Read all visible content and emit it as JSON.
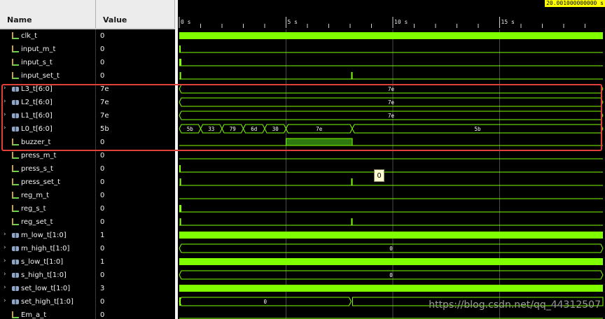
{
  "header": {
    "name_label": "Name",
    "value_label": "Value"
  },
  "ruler": {
    "ticks": [
      "0 s",
      "5 s",
      "10 s",
      "15 s"
    ],
    "cursor_time": "20.001000000000 s"
  },
  "signals": [
    {
      "name": "clk_t",
      "value": "0",
      "type": "bit",
      "expandable": false
    },
    {
      "name": "input_m_t",
      "value": "0",
      "type": "bit",
      "expandable": false
    },
    {
      "name": "input_s_t",
      "value": "0",
      "type": "bit",
      "expandable": false
    },
    {
      "name": "input_set_t",
      "value": "0",
      "type": "bit",
      "expandable": false
    },
    {
      "name": "L3_t[6:0]",
      "value": "7e",
      "type": "bus",
      "expandable": true
    },
    {
      "name": "L2_t[6:0]",
      "value": "7e",
      "type": "bus",
      "expandable": true
    },
    {
      "name": "L1_t[6:0]",
      "value": "7e",
      "type": "bus",
      "expandable": true
    },
    {
      "name": "L0_t[6:0]",
      "value": "5b",
      "type": "bus",
      "expandable": true
    },
    {
      "name": "buzzer_t",
      "value": "0",
      "type": "bit",
      "expandable": false
    },
    {
      "name": "press_m_t",
      "value": "0",
      "type": "bit",
      "expandable": false
    },
    {
      "name": "press_s_t",
      "value": "0",
      "type": "bit",
      "expandable": false
    },
    {
      "name": "press_set_t",
      "value": "0",
      "type": "bit",
      "expandable": false
    },
    {
      "name": "reg_m_t",
      "value": "0",
      "type": "bit",
      "expandable": false
    },
    {
      "name": "reg_s_t",
      "value": "0",
      "type": "bit",
      "expandable": false
    },
    {
      "name": "reg_set_t",
      "value": "0",
      "type": "bit",
      "expandable": false
    },
    {
      "name": "m_low_t[1:0]",
      "value": "1",
      "type": "bus",
      "expandable": true
    },
    {
      "name": "m_high_t[1:0]",
      "value": "0",
      "type": "bus",
      "expandable": true
    },
    {
      "name": "s_low_t[1:0]",
      "value": "1",
      "type": "bus",
      "expandable": true
    },
    {
      "name": "s_high_t[1:0]",
      "value": "0",
      "type": "bus",
      "expandable": true
    },
    {
      "name": "set_low_t[1:0]",
      "value": "3",
      "type": "bus",
      "expandable": true
    },
    {
      "name": "set_high_t[1:0]",
      "value": "0",
      "type": "bus",
      "expandable": true
    },
    {
      "name": "Em_a_t",
      "value": "0",
      "type": "bit",
      "expandable": false
    }
  ],
  "bus_segments": {
    "L3": [
      {
        "label": "7e"
      }
    ],
    "L2": [
      {
        "label": "7e"
      }
    ],
    "L1": [
      {
        "label": "7e"
      }
    ],
    "L0": [
      {
        "label": "5b"
      },
      {
        "label": "33"
      },
      {
        "label": "79"
      },
      {
        "label": "6d"
      },
      {
        "label": "30"
      },
      {
        "label": "7e"
      },
      {
        "label": "5b"
      }
    ],
    "m_high": [
      {
        "label": "0"
      }
    ],
    "s_high": [
      {
        "label": "0"
      }
    ],
    "set_high": [
      {
        "label": "0"
      }
    ]
  },
  "tooltip_value": "0",
  "watermark": "https://blog.csdn.net/qq_44312507",
  "colors": {
    "wave": "#7fff00",
    "bus_fill": "#2f7a10",
    "highlight": "#e0403a",
    "cursor": "#ffff00"
  }
}
